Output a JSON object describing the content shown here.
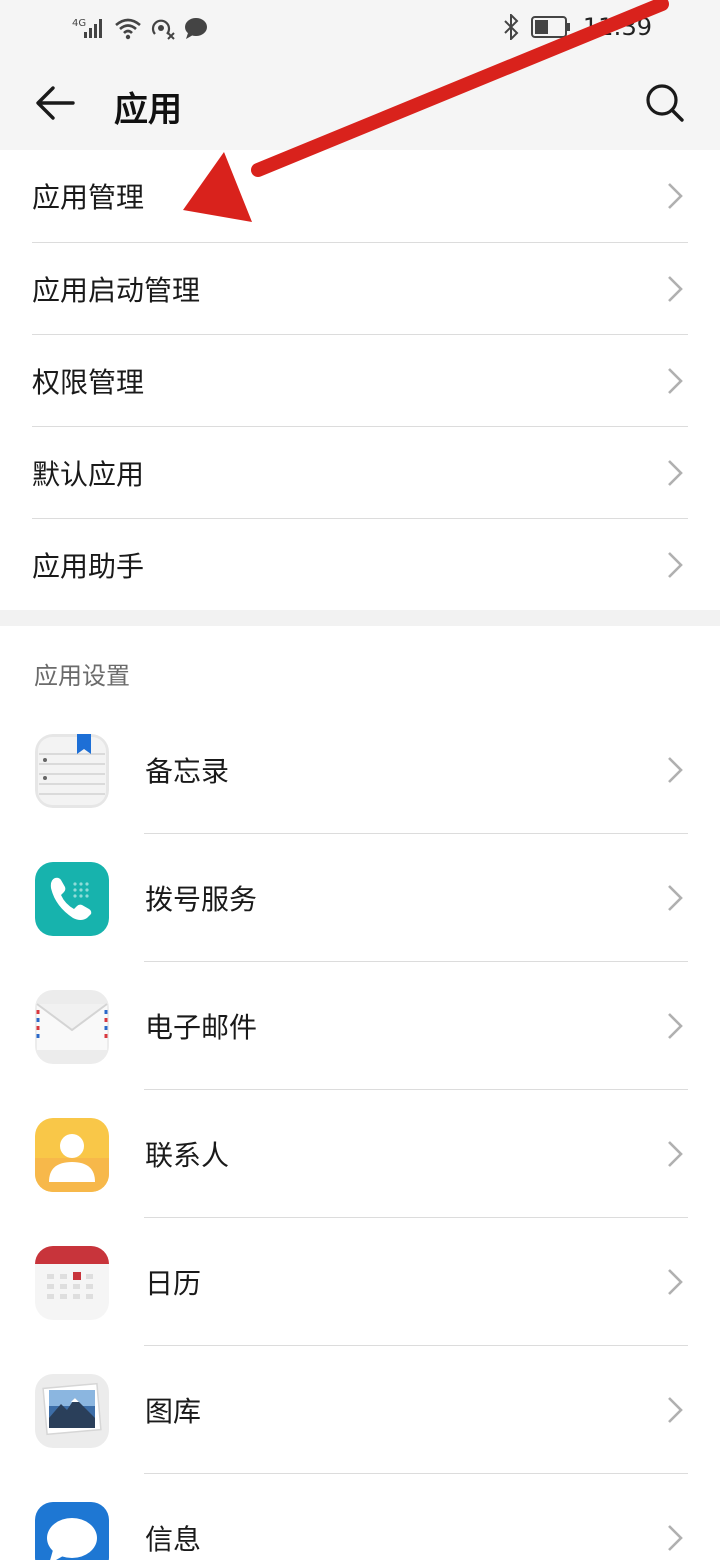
{
  "status_bar": {
    "network": "4G",
    "time": "11:39"
  },
  "header": {
    "title": "应用"
  },
  "main_menu": [
    {
      "label": "应用管理"
    },
    {
      "label": "应用启动管理"
    },
    {
      "label": "权限管理"
    },
    {
      "label": "默认应用"
    },
    {
      "label": "应用助手"
    }
  ],
  "app_settings": {
    "title": "应用设置",
    "apps": [
      {
        "label": "备忘录",
        "icon": "notepad-icon"
      },
      {
        "label": "拨号服务",
        "icon": "phone-icon"
      },
      {
        "label": "电子邮件",
        "icon": "email-icon"
      },
      {
        "label": "联系人",
        "icon": "contacts-icon"
      },
      {
        "label": "日历",
        "icon": "calendar-icon"
      },
      {
        "label": "图库",
        "icon": "gallery-icon"
      },
      {
        "label": "信息",
        "icon": "messages-icon"
      }
    ]
  },
  "colors": {
    "annotation_arrow": "#d9221c",
    "header_bg": "#f5f5f5",
    "phone_icon": "#17b3ad",
    "contacts_icon": "#f9c748",
    "calendar_top": "#c8343b",
    "messages_icon": "#1e77d3"
  }
}
